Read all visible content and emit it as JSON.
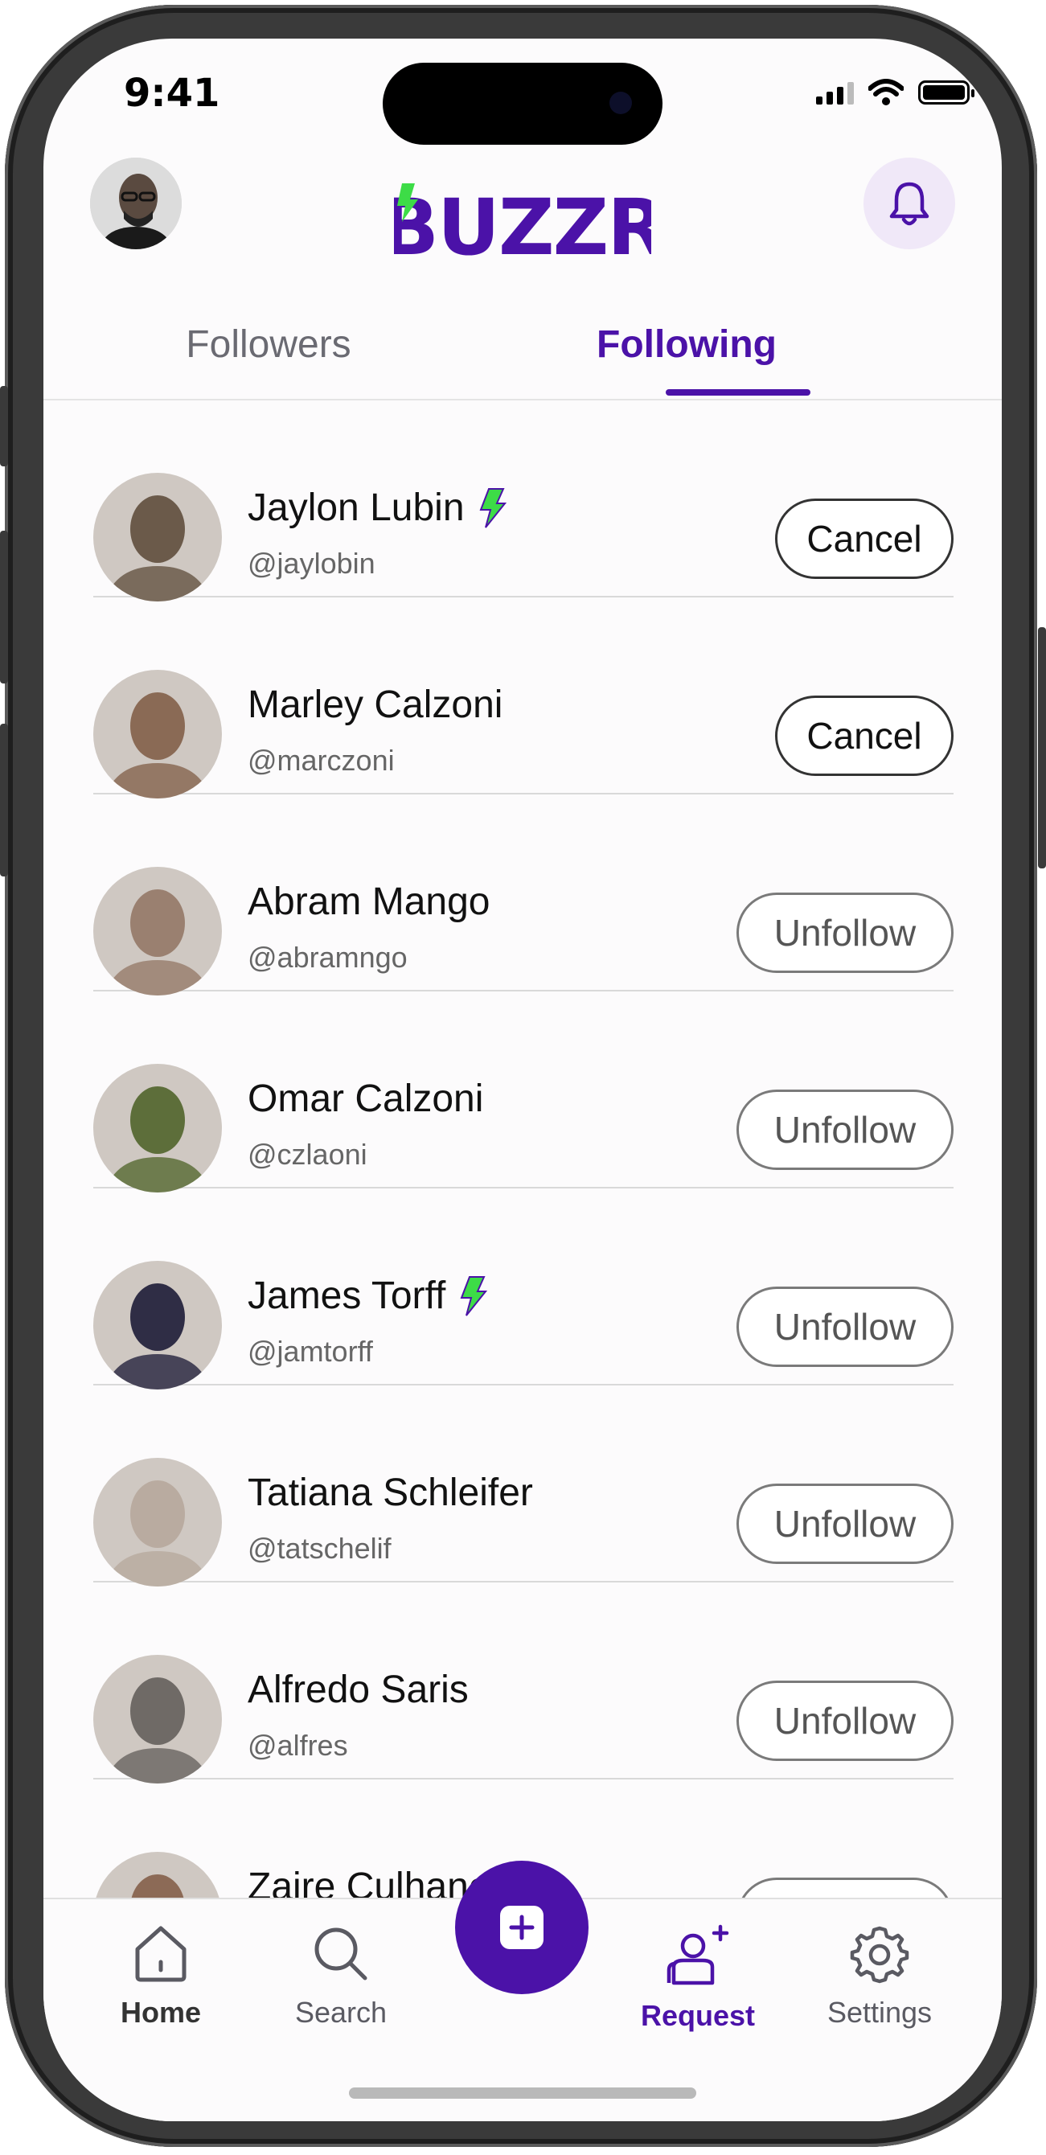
{
  "status_bar": {
    "time": "9:41"
  },
  "header": {
    "logo_text": "BUZZR",
    "brand_color": "#4b12a8",
    "bolt_color": "#3ddc47"
  },
  "tabs": [
    {
      "label": "Followers",
      "active": false
    },
    {
      "label": "Following",
      "active": true
    }
  ],
  "users": [
    {
      "name": "Jaylon Lubin",
      "handle": "@jaylobin",
      "verified": true,
      "action": "Cancel",
      "avatar_color": "#6b5a4a"
    },
    {
      "name": "Marley Calzoni",
      "handle": "@marczoni",
      "verified": false,
      "action": "Cancel",
      "avatar_color": "#8a6a55"
    },
    {
      "name": "Abram Mango",
      "handle": "@abramngo",
      "verified": false,
      "action": "Unfollow",
      "avatar_color": "#9a8070"
    },
    {
      "name": "Omar Calzoni",
      "handle": "@czlaoni",
      "verified": false,
      "action": "Unfollow",
      "avatar_color": "#5d6e3a"
    },
    {
      "name": "James Torff",
      "handle": "@jamtorff",
      "verified": true,
      "action": "Unfollow",
      "avatar_color": "#2f2d45"
    },
    {
      "name": "Tatiana Schleifer",
      "handle": "@tatschelif",
      "verified": false,
      "action": "Unfollow",
      "avatar_color": "#b9aba0"
    },
    {
      "name": "Alfredo Saris",
      "handle": "@alfres",
      "verified": false,
      "action": "Unfollow",
      "avatar_color": "#6f6a66"
    },
    {
      "name": "Zaire Culhane",
      "handle": "",
      "verified": false,
      "action": "Unfollow",
      "avatar_color": "#8c6a56"
    }
  ],
  "nav": {
    "home": "Home",
    "search": "Search",
    "request": "Request",
    "settings": "Settings"
  }
}
